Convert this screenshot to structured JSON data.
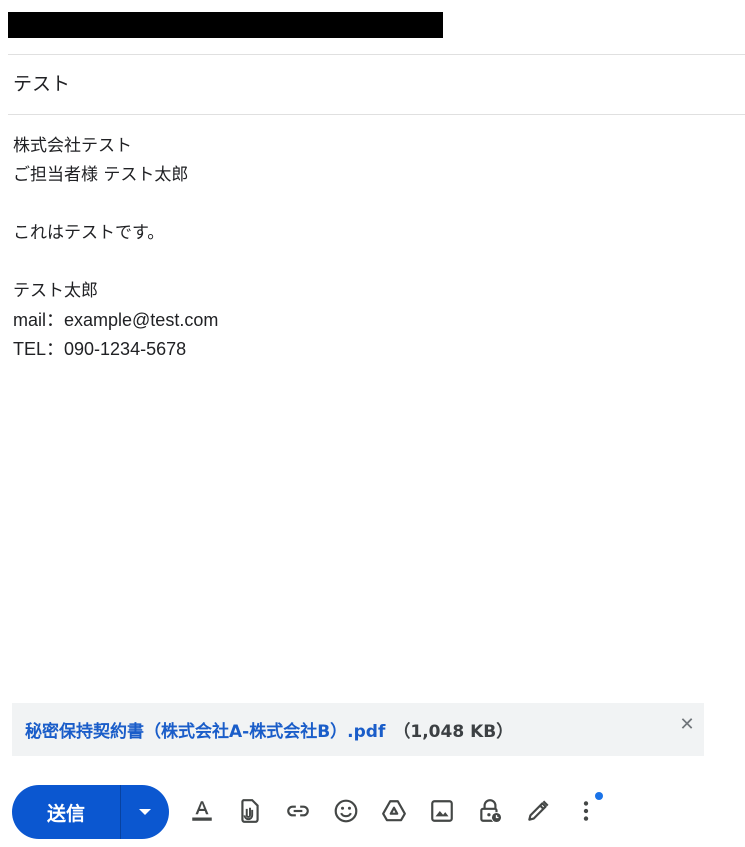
{
  "compose": {
    "subject": "テスト",
    "body_lines": [
      "株式会社テスト",
      "ご担当者様 テスト太郎",
      "",
      "これはテストです。",
      "",
      "テスト太郎",
      "mail：example@test.com",
      "TEL：090-1234-5678"
    ]
  },
  "attachment": {
    "name": "秘密保持契約書（株式会社A-株式会社B）.pdf",
    "size": "（1,048 KB）"
  },
  "toolbar": {
    "send_label": "送信",
    "icons": [
      "formatting-options-icon",
      "attach-file-icon",
      "insert-link-icon",
      "emoji-icon",
      "google-drive-icon",
      "insert-photo-icon",
      "confidential-mode-icon",
      "signature-icon",
      "more-options-icon"
    ],
    "accent_color": "#0b57d0",
    "notification_color": "#1a73e8"
  }
}
